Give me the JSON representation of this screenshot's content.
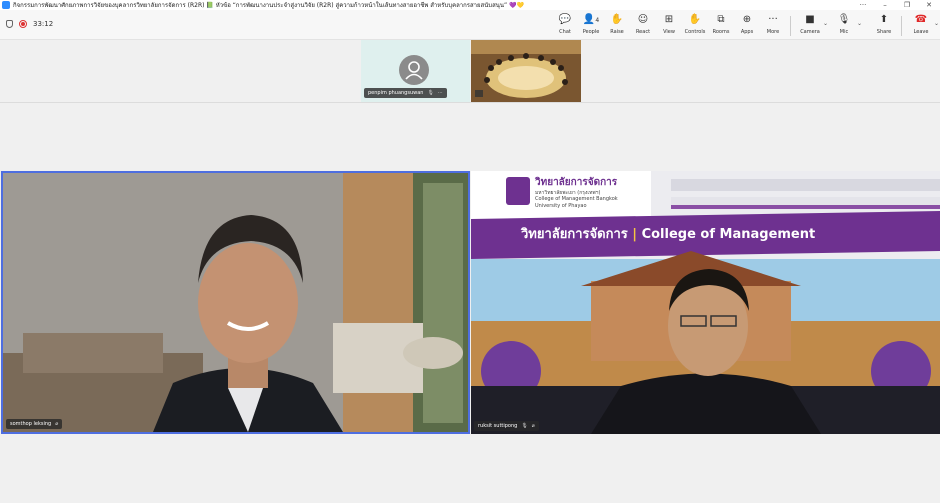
{
  "window": {
    "title": "กิจกรรมการพัฒนาศักยภาพการวิจัยของบุคลากรวิทยาลัยการจัดการ (R2R) 📗 หัวข้อ “การพัฒนางานประจำสู่งานวิจัย (R2R) สู่ความก้าวหน้าในเส้นทางสายอาชีพ สำหรับบุคลากรสายสนับสนุน” 💜💛",
    "more": "···",
    "minimize": "–",
    "restore": "❐",
    "close": "✕"
  },
  "meeting": {
    "timer": "33:12"
  },
  "toolbar": {
    "items": [
      {
        "label": "Chat",
        "icon": "chat-icon",
        "glyph": "💬"
      },
      {
        "label": "People",
        "icon": "people-icon",
        "glyph": "👤",
        "badge": "4"
      },
      {
        "label": "Raise",
        "icon": "raise-hand-icon",
        "glyph": "✋"
      },
      {
        "label": "React",
        "icon": "react-icon",
        "glyph": "☺"
      },
      {
        "label": "View",
        "icon": "view-icon",
        "glyph": "⊞"
      },
      {
        "label": "Controls",
        "icon": "controls-icon",
        "glyph": "✋"
      },
      {
        "label": "Rooms",
        "icon": "rooms-icon",
        "glyph": "⧉"
      },
      {
        "label": "Apps",
        "icon": "apps-icon",
        "glyph": "⊕"
      },
      {
        "label": "More",
        "icon": "more-icon",
        "glyph": "···"
      }
    ],
    "camera": {
      "label": "Camera",
      "glyph": "■"
    },
    "mic": {
      "label": "Mic",
      "glyph": "🎙"
    },
    "share": {
      "label": "Share",
      "glyph": "⬆"
    },
    "leave": {
      "label": "Leave",
      "glyph": "☎"
    },
    "caret": "⌄"
  },
  "participants": {
    "thumb1": {
      "name": "penpim phuangsuwan"
    },
    "pinned_left": {
      "name": "somthop leksing"
    },
    "pinned_right": {
      "name": "ruksit suttipong"
    }
  },
  "slide": {
    "title_th": "วิทยาลัยการจัดการ",
    "subtitle_th": "มหาวิทยาลัยพะเยา (กรุงเทพฯ)",
    "line_en1": "College of Management Bangkok",
    "line_en2": "University of Phayao",
    "banner_th": "วิทยาลัยการจัดการ",
    "banner_en": "College of Management"
  }
}
